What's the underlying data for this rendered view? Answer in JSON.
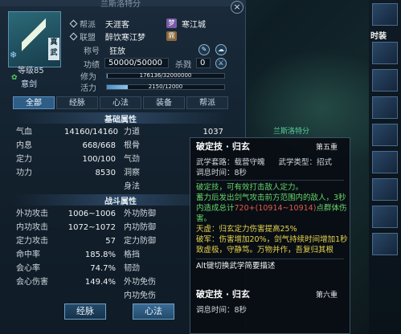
{
  "window": {
    "title": "兰斯洛特分",
    "close_label": "×"
  },
  "profile": {
    "portrait_tag": "真武",
    "level": "等级85",
    "badge_label": "意剑",
    "faction_label": "帮派",
    "faction_value": "天涯客",
    "server": "寒江城",
    "alliance_label": "联盟",
    "alliance_value": "醉饮寒江梦",
    "title_label": "称号",
    "title_value": "狂放",
    "merit_label": "功绩",
    "merit_value": "50000/50000",
    "kill_label": "杀戮",
    "kill_value": "0",
    "cultivation_label": "修为",
    "cultivation_text": "176136/32000000",
    "cultivation_fraction": 0.0055,
    "vitality_label": "活力",
    "vitality_text": "2150/12000",
    "vitality_fraction": 0.179
  },
  "tabs": [
    {
      "label": "全部",
      "active": true
    },
    {
      "label": "经脉",
      "active": false
    },
    {
      "label": "心法",
      "active": false
    },
    {
      "label": "装备",
      "active": false
    },
    {
      "label": "帮派",
      "active": false
    }
  ],
  "basic_title": "基础属性",
  "basic_left": [
    {
      "k": "气血",
      "v": "14160/14160"
    },
    {
      "k": "内息",
      "v": "668/668"
    },
    {
      "k": "定力",
      "v": "100/100"
    },
    {
      "k": "功力",
      "v": "8530"
    }
  ],
  "basic_right": [
    {
      "k": "力道",
      "v": "1037"
    },
    {
      "k": "根骨",
      "v": ""
    },
    {
      "k": "气劲",
      "v": ""
    },
    {
      "k": "洞察",
      "v": ""
    },
    {
      "k": "身法",
      "v": ""
    }
  ],
  "combat_title": "战斗属性",
  "combat_left": [
    {
      "k": "外功攻击",
      "v": "1006~1006"
    },
    {
      "k": "内功攻击",
      "v": "1072~1072"
    },
    {
      "k": "定力攻击",
      "v": "57"
    },
    {
      "k": "命中率",
      "v": "185.8%"
    },
    {
      "k": "会心率",
      "v": "74.7%"
    },
    {
      "k": "会心伤害",
      "v": "149.4%"
    }
  ],
  "combat_right": [
    {
      "k": "外功防御"
    },
    {
      "k": "内功防御"
    },
    {
      "k": "定力防御"
    },
    {
      "k": "格挡"
    },
    {
      "k": "韧劲"
    },
    {
      "k": "外功免伤"
    },
    {
      "k": "内功免伤"
    }
  ],
  "bottom_buttons": {
    "left": "经脉",
    "right": "心法"
  },
  "tooltip": {
    "title": "破定技 · 归玄",
    "rank": "第五重",
    "type_label": "武学套路：载营守魄",
    "kind_label": "武学类型：招式",
    "cooldown": "调息时间：8秒",
    "line1": "破定技，可有效打击敌人定力。",
    "line2": "蓄力后发出剑气攻击前方范围内的敌人，3秒",
    "line3a": "内造成总计",
    "line3b": "720+(10914~10914)",
    "line3c": "点群体伤",
    "line4": "害。",
    "line5": "天虚：归玄定力伤害提高25%",
    "line6": "破军：伤害增加20%，剑气持续时间增加1秒",
    "line7": "致虚极，守静笃。万物并作，吾复归其根",
    "hint": "Alt键切换武学简要描述",
    "next_title": "破定技 · 归玄",
    "next_rank": "第六重",
    "next_cooldown": "调息时间：8秒"
  },
  "right_bar": {
    "label": "时装"
  },
  "scene": {
    "name": "兰斯洛特分"
  }
}
